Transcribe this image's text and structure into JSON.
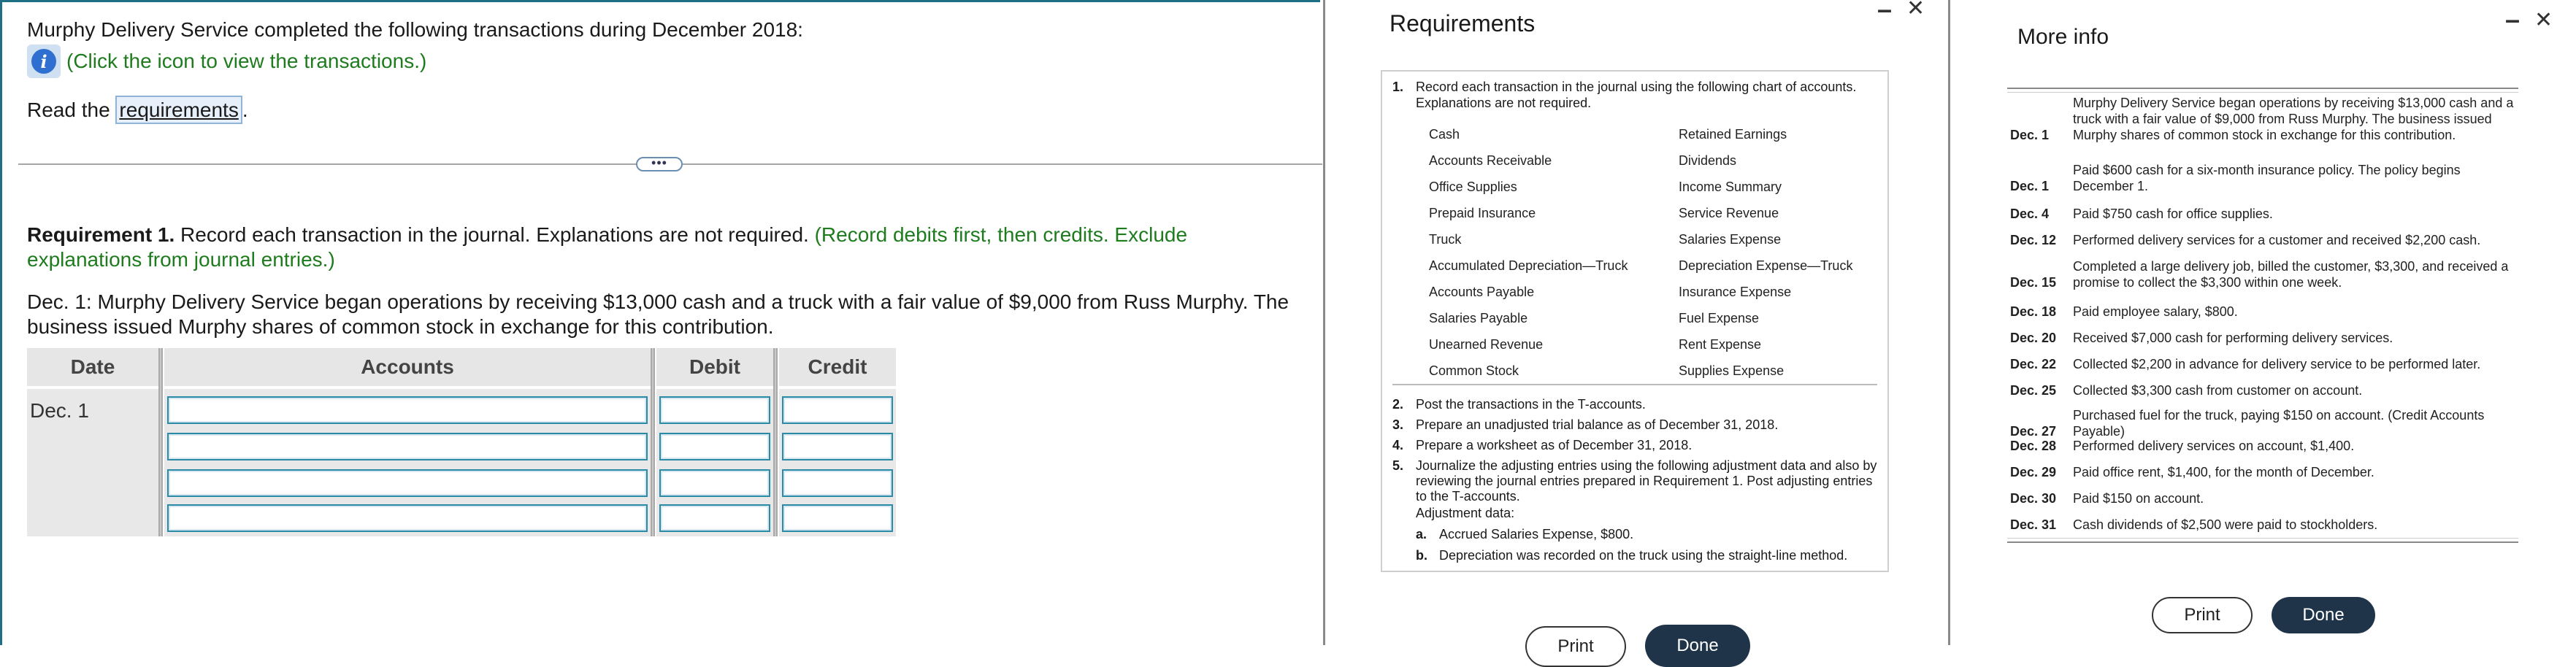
{
  "main": {
    "intro": "Murphy Delivery Service completed the following transactions during December 2018:",
    "info_link": "(Click the icon to view the transactions.)",
    "read_prefix": "Read the ",
    "read_link": "requirements",
    "read_suffix": ".",
    "dots": "•••",
    "req1_bold": "Requirement 1.",
    "req1_text": " Record each transaction in the journal. Explanations are not required. ",
    "req1_green": "(Record debits first, then credits. Exclude explanations from journal entries.)",
    "dec1_text": "Dec. 1: Murphy Delivery Service began operations by receiving $13,000 cash and a truck with a fair value of $9,000 from Russ Murphy. The business issued Murphy shares of common stock in exchange for this contribution.",
    "table": {
      "headers": [
        "Date",
        "Accounts",
        "Debit",
        "Credit"
      ],
      "date_value": "Dec. 1"
    },
    "colors": {
      "link_green": "#1e7b1e",
      "input_border": "#2b8aa6",
      "info_blue": "#2f6fcf"
    }
  },
  "requirements_panel": {
    "title": "Requirements",
    "minimize": "–",
    "close": "✕",
    "item1_num": "1.",
    "item1_text": "Record each transaction in the journal using the following chart of accounts. Explanations are not required.",
    "accounts_left": [
      "Cash",
      "Accounts Receivable",
      "Office Supplies",
      "Prepaid Insurance",
      "Truck",
      "Accumulated Depreciation—Truck",
      "Accounts Payable",
      "Salaries Payable",
      "Unearned Revenue",
      "Common Stock"
    ],
    "accounts_right": [
      "Retained Earnings",
      "Dividends",
      "Income Summary",
      "Service Revenue",
      "Salaries Expense",
      "Depreciation Expense—Truck",
      "Insurance Expense",
      "Fuel Expense",
      "Rent Expense",
      "Supplies Expense"
    ],
    "items": [
      {
        "num": "2.",
        "text": "Post the transactions in the T-accounts."
      },
      {
        "num": "3.",
        "text": "Prepare an unadjusted trial balance as of December 31, 2018."
      },
      {
        "num": "4.",
        "text": "Prepare a worksheet as of December 31, 2018."
      },
      {
        "num": "5.",
        "text": "Journalize the adjusting entries using the following adjustment data and also by reviewing the journal entries prepared in Requirement 1. Post adjusting entries to the T-accounts."
      }
    ],
    "adjustment_label": "Adjustment data:",
    "adjustments": [
      {
        "letter": "a.",
        "text": "Accrued Salaries Expense, $800."
      },
      {
        "letter": "b.",
        "text": "Depreciation was recorded on the truck using the straight-line method."
      }
    ],
    "print_label": "Print",
    "done_label": "Done"
  },
  "info_panel": {
    "title": "More info",
    "minimize": "–",
    "close": "✕",
    "transactions": [
      {
        "date": "Dec. 1",
        "text": "Murphy Delivery Service began operations by receiving $13,000 cash and a truck with a fair value of $9,000 from Russ Murphy. The business issued Murphy shares of common stock in exchange for this contribution."
      },
      {
        "date": "Dec. 1",
        "text": "Paid $600 cash for a six-month insurance policy. The policy begins December 1."
      },
      {
        "date": "Dec. 4",
        "text": "Paid $750 cash for office supplies."
      },
      {
        "date": "Dec. 12",
        "text": "Performed delivery services for a customer and received $2,200 cash."
      },
      {
        "date": "Dec. 15",
        "text": "Completed a large delivery job, billed the customer, $3,300, and received a promise to collect the $3,300 within one week."
      },
      {
        "date": "Dec. 18",
        "text": "Paid employee salary, $800."
      },
      {
        "date": "Dec. 20",
        "text": "Received $7,000 cash for performing delivery services."
      },
      {
        "date": "Dec. 22",
        "text": "Collected $2,200 in advance for delivery service to be performed later."
      },
      {
        "date": "Dec. 25",
        "text": "Collected $3,300 cash from customer on account."
      },
      {
        "date": "Dec. 27",
        "text": "Purchased fuel for the truck, paying $150 on account. (Credit Accounts Payable)"
      },
      {
        "date": "Dec. 28",
        "text": "Performed delivery services on account, $1,400."
      },
      {
        "date": "Dec. 29",
        "text": "Paid office rent, $1,400, for the month of December."
      },
      {
        "date": "Dec. 30",
        "text": "Paid $150 on account."
      },
      {
        "date": "Dec. 31",
        "text": "Cash dividends of $2,500 were paid to stockholders."
      }
    ],
    "print_label": "Print",
    "done_label": "Done"
  }
}
